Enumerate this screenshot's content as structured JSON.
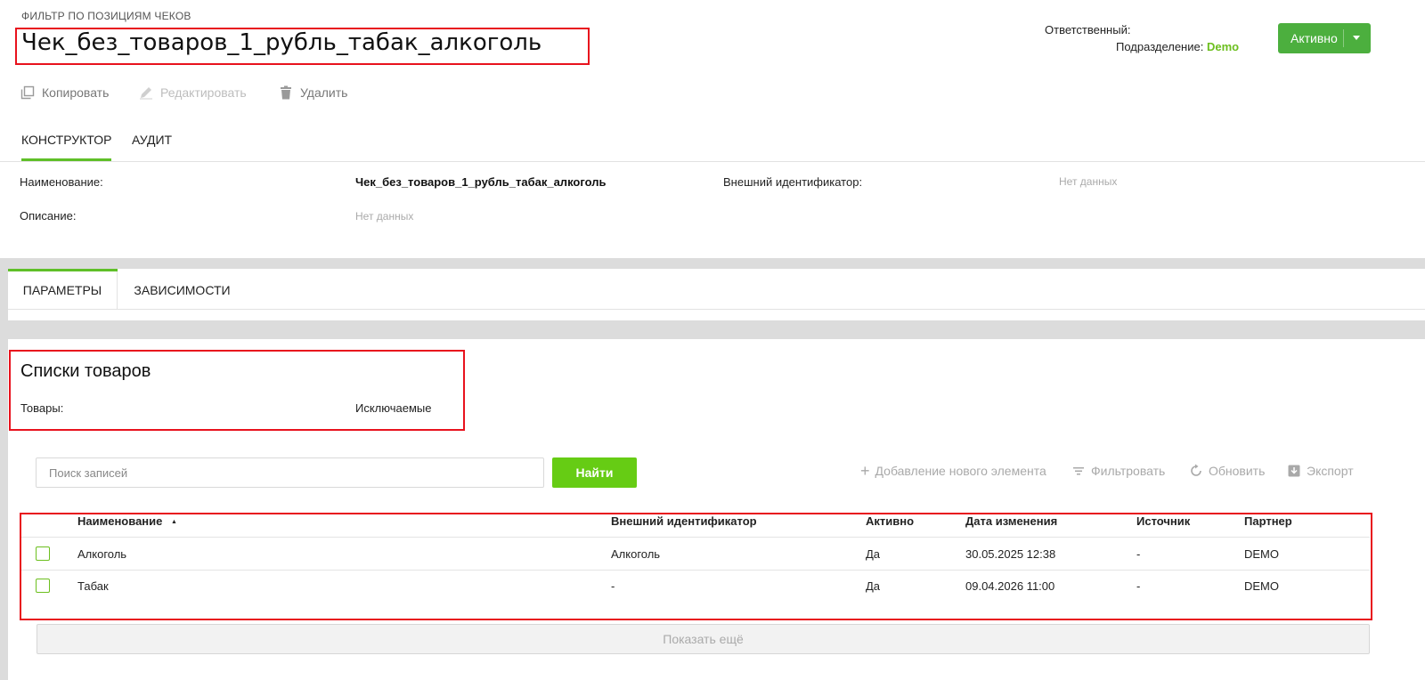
{
  "header": {
    "category": "ФИЛЬТР ПО ПОЗИЦИЯМ ЧЕКОВ",
    "title": "Чек_без_товаров_1_рубль_табак_алкоголь",
    "responsible_label": "Ответственный:",
    "responsible_value": "",
    "division_label": "Подразделение:",
    "division_value": "Demo",
    "status_label": "Активно"
  },
  "actions": {
    "copy": "Копировать",
    "edit": "Редактировать",
    "delete": "Удалить"
  },
  "tabs": [
    {
      "label": "КОНСТРУКТОР",
      "active": true
    },
    {
      "label": "АУДИТ",
      "active": false
    }
  ],
  "info": {
    "name_label": "Наименование:",
    "name_value": "Чек_без_товаров_1_рубль_табак_алкоголь",
    "external_id_label": "Внешний идентификатор:",
    "external_id_value": "Нет данных",
    "description_label": "Описание:",
    "description_value": "Нет данных"
  },
  "subtabs": [
    {
      "label": "ПАРАМЕТРЫ",
      "active": true
    },
    {
      "label": "ЗАВИСИМОСТИ",
      "active": false
    }
  ],
  "product_lists": {
    "title": "Списки товаров",
    "goods_label": "Товары:",
    "goods_value": "Исключаемые"
  },
  "search": {
    "placeholder": "Поиск записей",
    "button": "Найти"
  },
  "toolbar": {
    "add": "Добавление нового элемента",
    "filter": "Фильтровать",
    "refresh": "Обновить",
    "export": "Экспорт"
  },
  "table": {
    "columns": [
      "Наименование",
      "Внешний идентификатор",
      "Активно",
      "Дата изменения",
      "Источник",
      "Партнер"
    ],
    "sort_indicator": "▲",
    "rows": [
      {
        "name": "Алкоголь",
        "external_id": "Алкоголь",
        "active": "Да",
        "modified": "30.05.2025 12:38",
        "source": "-",
        "partner": "DEMO"
      },
      {
        "name": "Табак",
        "external_id": "-",
        "active": "Да",
        "modified": "09.04.2026 11:00",
        "source": "-",
        "partner": "DEMO"
      }
    ],
    "show_more": "Показать ещё"
  },
  "colors": {
    "accent_green": "#6cbf1e",
    "status_green": "#4caf3e",
    "highlight_red": "#e8121d"
  }
}
